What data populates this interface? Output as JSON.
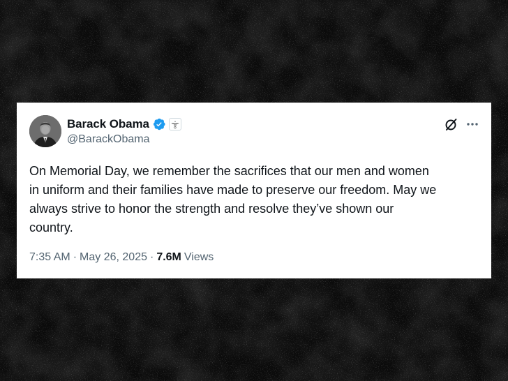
{
  "tweet": {
    "author": {
      "display_name": "Barack Obama",
      "handle": "@BarackObama",
      "verified_badge": "verified-checkmark-icon",
      "affiliation_badge": "government-seal-icon"
    },
    "text": "On Memorial Day, we remember the sacrifices that our men and women\nin uniform and their families have made to preserve our freedom. May we\nalways strive to honor the strength and resolve they’ve shown our\ncountry.",
    "time": "7:35 AM",
    "separator": "·",
    "date": "May 26, 2025",
    "views_count": "7.6M",
    "views_label": "Views"
  },
  "icons": {
    "grok": "grok-icon",
    "more": "more-options-icon"
  },
  "colors": {
    "background": "#0c0c0c",
    "card": "#ffffff",
    "text_primary": "#0f1419",
    "text_secondary": "#536471",
    "verified_blue": "#1d9bf0"
  }
}
